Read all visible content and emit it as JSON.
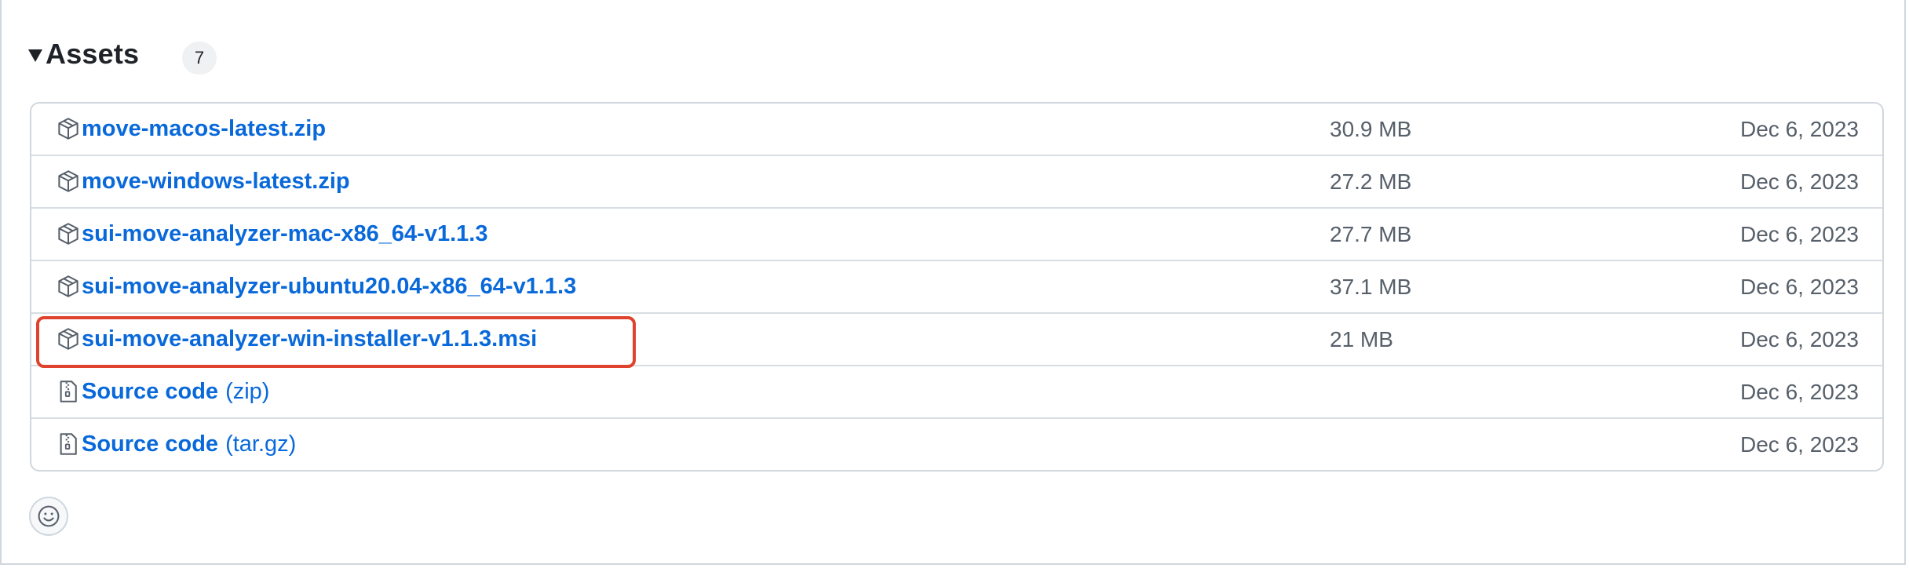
{
  "assets": {
    "title": "Assets",
    "count": "7",
    "items": [
      {
        "name": "move-macos-latest.zip",
        "suffix": "",
        "size": "30.9 MB",
        "date": "Dec 6, 2023",
        "icon": "package-icon"
      },
      {
        "name": "move-windows-latest.zip",
        "suffix": "",
        "size": "27.2 MB",
        "date": "Dec 6, 2023",
        "icon": "package-icon"
      },
      {
        "name": "sui-move-analyzer-mac-x86_64-v1.1.3",
        "suffix": "",
        "size": "27.7 MB",
        "date": "Dec 6, 2023",
        "icon": "package-icon"
      },
      {
        "name": "sui-move-analyzer-ubuntu20.04-x86_64-v1.1.3",
        "suffix": "",
        "size": "37.1 MB",
        "date": "Dec 6, 2023",
        "icon": "package-icon"
      },
      {
        "name": "sui-move-analyzer-win-installer-v1.1.3.msi",
        "suffix": "",
        "size": "21 MB",
        "date": "Dec 6, 2023",
        "icon": "package-icon"
      },
      {
        "name": "Source code",
        "suffix": "(zip)",
        "size": "",
        "date": "Dec 6, 2023",
        "icon": "file-zip-icon"
      },
      {
        "name": "Source code",
        "suffix": "(tar.gz)",
        "size": "",
        "date": "Dec 6, 2023",
        "icon": "file-zip-icon"
      }
    ]
  },
  "highlight": {
    "color": "#e0432d",
    "target": "sui-move-analyzer-win-installer-v1.1.3.msi"
  },
  "colors": {
    "link": "#0969da",
    "muted": "#57606a",
    "border": "#d0d7de"
  },
  "reaction": {
    "icon": "smiley-icon"
  }
}
